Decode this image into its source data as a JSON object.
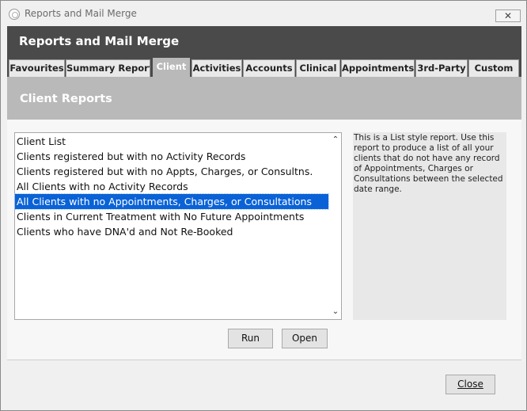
{
  "window": {
    "title": "Reports and Mail Merge",
    "close_glyph": "✕"
  },
  "header": {
    "title": "Reports and Mail Merge"
  },
  "tabs": [
    {
      "label": "Favourites"
    },
    {
      "label": "Summary Reports"
    },
    {
      "label": "Client",
      "active": true
    },
    {
      "label": "Activities"
    },
    {
      "label": "Accounts"
    },
    {
      "label": "Clinical"
    },
    {
      "label": "Appointments"
    },
    {
      "label": "3rd-Party"
    },
    {
      "label": "Custom"
    }
  ],
  "section": {
    "title": "Client Reports"
  },
  "reports": [
    "Client List",
    "Clients registered but with no Activity Records",
    "Clients registered but with no Appts, Charges, or Consultns.",
    "All Clients with no Activity Records",
    "All Clients with no Appointments, Charges, or Consultations",
    "Clients in Current Treatment with No Future Appointments",
    "Clients who have DNA'd and Not Re-Booked"
  ],
  "selected_report": "All Clients with no Appointments, Charges, or Consultations",
  "scroll": {
    "up_glyph": "⌃",
    "down_glyph": "⌄"
  },
  "description": "This is a List style report. Use this report to produce a list of all your clients that do not have any record of Appointments, Charges or Consultations between the selected date range.",
  "buttons": {
    "run": "Run",
    "open": "Open",
    "close": "Close"
  },
  "colors": {
    "header": "#4a4a4a",
    "subheader": "#b9b9b9",
    "selection": "#0a62d6"
  }
}
